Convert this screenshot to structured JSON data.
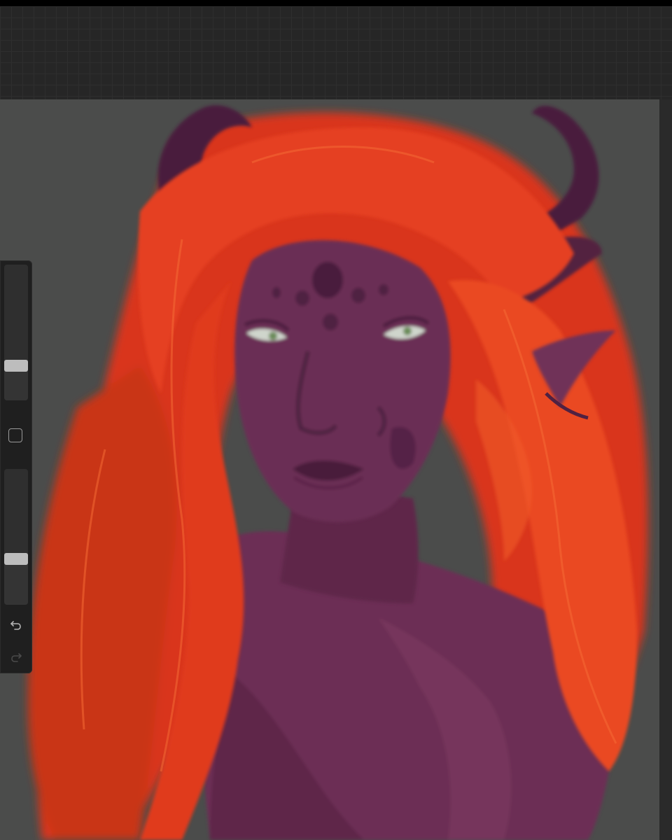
{
  "app": {
    "name": "drawing-app"
  },
  "canvas": {
    "background_color": "#4b4c4b",
    "artwork_description_colors": {
      "hair": "#e23a1c",
      "hair_highlight": "#f0521f",
      "skin": "#6c2f55",
      "skin_shadow": "#582445",
      "horn": "#4a1f3c",
      "eye": "#c9d2c7"
    }
  },
  "sidebar": {
    "brush_size": {
      "level": 0.23
    },
    "modify_icon": "square-icon",
    "opacity": {
      "level": 0.32
    },
    "undo_icon": "undo-arrow-icon",
    "redo_icon": "redo-arrow-icon"
  }
}
